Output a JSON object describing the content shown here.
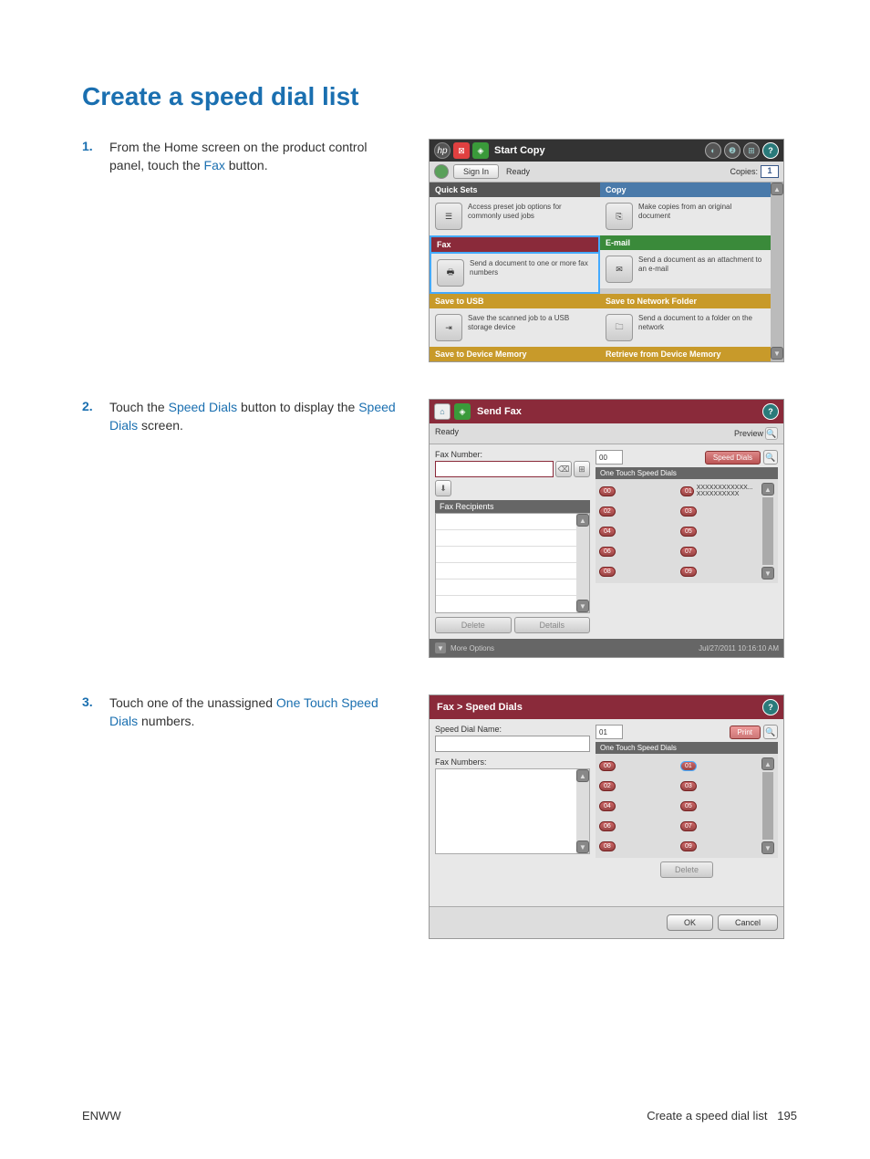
{
  "page_title": "Create a speed dial list",
  "steps": [
    {
      "num": "1.",
      "pre": "From the Home screen on the product control panel, touch the ",
      "link": "Fax",
      "post": " button."
    },
    {
      "num": "2.",
      "pre": "Touch the ",
      "link": "Speed Dials",
      "mid": " button to display the ",
      "link2": "Speed Dials",
      "post": " screen."
    },
    {
      "num": "3.",
      "pre": "Touch one of the unassigned ",
      "link": "One Touch Speed Dials",
      "post": " numbers."
    }
  ],
  "shot1": {
    "start_copy": "Start Copy",
    "sign_in": "Sign In",
    "ready": "Ready",
    "copies": "Copies:",
    "copies_val": "1",
    "tiles": {
      "quick_sets": {
        "hdr": "Quick Sets",
        "desc": "Access preset job options for commonly used jobs"
      },
      "copy": {
        "hdr": "Copy",
        "desc": "Make copies from an original document"
      },
      "fax": {
        "hdr": "Fax",
        "desc": "Send a document to one or more fax numbers"
      },
      "email": {
        "hdr": "E-mail",
        "desc": "Send a document as an attachment to an e-mail"
      },
      "usb": {
        "hdr": "Save to USB",
        "desc": "Save the scanned job to a USB storage device"
      },
      "network": {
        "hdr": "Save to Network Folder",
        "desc": "Send a document to a folder on the network"
      },
      "save_mem": {
        "hdr": "Save to Device Memory"
      },
      "retr_mem": {
        "hdr": "Retrieve from Device Memory"
      }
    }
  },
  "shot2": {
    "title": "Send Fax",
    "ready": "Ready",
    "preview": "Preview",
    "fax_number": "Fax Number:",
    "fax_recipients": "Fax Recipients",
    "delete": "Delete",
    "details": "Details",
    "sd_num": "00",
    "speed_dials": "Speed Dials",
    "one_touch": "One Touch Speed Dials",
    "entries": [
      {
        "n": "00",
        "l": ""
      },
      {
        "n": "01",
        "l": "XXXXXXXXXXXX... XXXXXXXXXX"
      },
      {
        "n": "02",
        "l": ""
      },
      {
        "n": "03",
        "l": ""
      },
      {
        "n": "04",
        "l": ""
      },
      {
        "n": "05",
        "l": ""
      },
      {
        "n": "06",
        "l": ""
      },
      {
        "n": "07",
        "l": ""
      },
      {
        "n": "08",
        "l": ""
      },
      {
        "n": "09",
        "l": ""
      }
    ],
    "more_options": "More Options",
    "timestamp": "Jul/27/2011 10:16:10 AM"
  },
  "shot3": {
    "title": "Fax > Speed Dials",
    "sd_name": "Speed Dial Name:",
    "fax_numbers": "Fax Numbers:",
    "sd_num": "01",
    "print": "Print",
    "one_touch": "One Touch Speed Dials",
    "entries": [
      {
        "n": "00"
      },
      {
        "n": "01",
        "sel": true
      },
      {
        "n": "02"
      },
      {
        "n": "03"
      },
      {
        "n": "04"
      },
      {
        "n": "05"
      },
      {
        "n": "06"
      },
      {
        "n": "07"
      },
      {
        "n": "08"
      },
      {
        "n": "09"
      }
    ],
    "delete": "Delete",
    "ok": "OK",
    "cancel": "Cancel"
  },
  "footer": {
    "left": "ENWW",
    "right_text": "Create a speed dial list",
    "right_num": "195"
  }
}
